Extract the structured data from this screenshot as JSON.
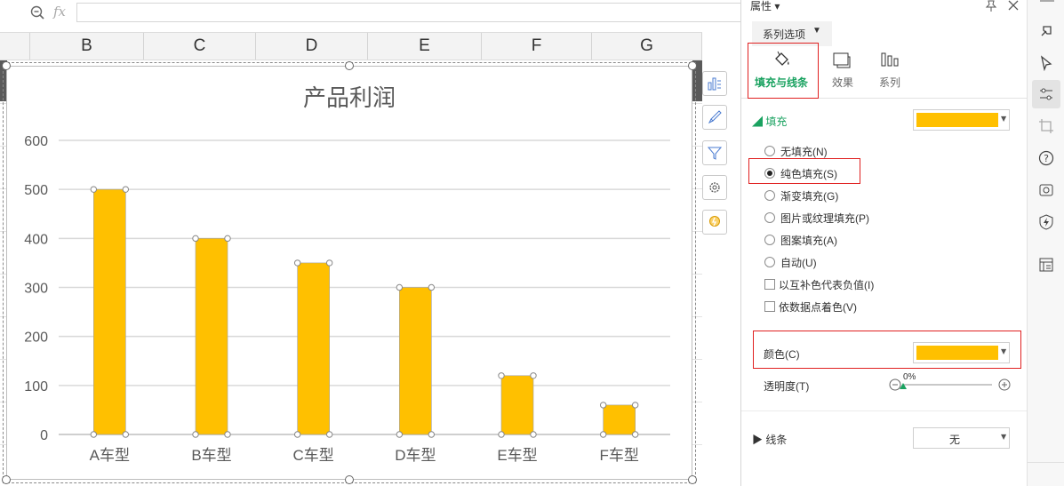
{
  "formula_bar": {
    "fx_label": "fx",
    "value": ""
  },
  "columns": [
    "B",
    "C",
    "D",
    "E",
    "F",
    "G"
  ],
  "chart_data": {
    "type": "bar",
    "title": "产品利润",
    "categories": [
      "A车型",
      "B车型",
      "C车型",
      "D车型",
      "E车型",
      "F车型"
    ],
    "values": [
      500,
      400,
      350,
      300,
      120,
      60
    ],
    "y_ticks": [
      "0",
      "100",
      "200",
      "300",
      "400",
      "500",
      "600"
    ],
    "ylim": [
      0,
      600
    ],
    "bar_color": "#FFC000",
    "grid": true
  },
  "panel": {
    "title": "属性",
    "dropdown_tab": "系列选项",
    "tabs": [
      {
        "label": "填充与线条",
        "icon": "paint-bucket-icon"
      },
      {
        "label": "效果",
        "icon": "effects-icon"
      },
      {
        "label": "系列",
        "icon": "series-bars-icon"
      }
    ],
    "fill_section": "填充",
    "fill_color": "#FFC000",
    "fill_options": [
      {
        "label": "无填充(N)",
        "checked": false
      },
      {
        "label": "纯色填充(S)",
        "checked": true
      },
      {
        "label": "渐变填充(G)",
        "checked": false
      },
      {
        "label": "图片或纹理填充(P)",
        "checked": false
      },
      {
        "label": "图案填充(A)",
        "checked": false
      },
      {
        "label": "自动(U)",
        "checked": false
      }
    ],
    "checkboxes": [
      {
        "label": "以互补色代表负值(I)",
        "checked": false
      },
      {
        "label": "依数据点着色(V)",
        "checked": false
      }
    ],
    "color_label": "颜色(C)",
    "color_value": "#FFC000",
    "transparency_label": "透明度(T)",
    "transparency_value": "0%",
    "transparency_fraction": 0.0,
    "line_section": "线条",
    "line_value": "无"
  },
  "right_bar_icons": [
    "pin-rocket-icon",
    "pointer-icon",
    "sliders-icon",
    "crop-icon",
    "help-icon",
    "backup-icon",
    "shield-bolt-icon",
    "table-list-icon"
  ],
  "colors": {
    "accent_green": "#1aa260",
    "highlight_red": "#e02020",
    "bar": "#FFC000"
  }
}
